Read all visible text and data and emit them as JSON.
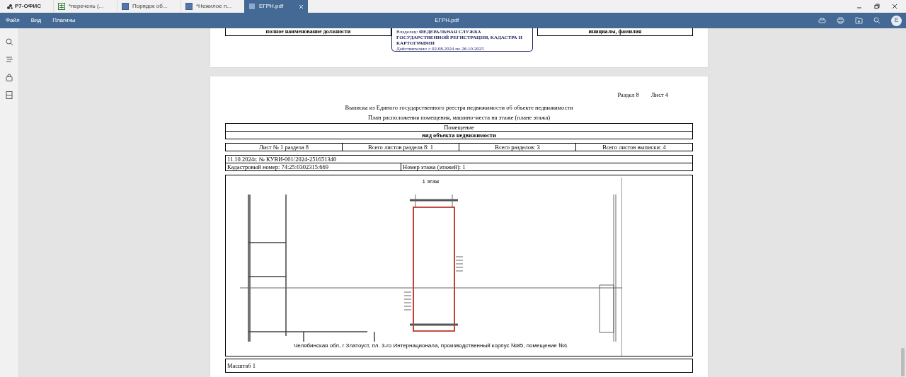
{
  "app": {
    "logo": "Р7-ОФИС"
  },
  "tabs": [
    {
      "label": "*перечень (...",
      "kind": "sheet",
      "selected": false
    },
    {
      "label": "Порядок об...",
      "kind": "doc",
      "selected": false
    },
    {
      "label": "*Нежилое п...",
      "kind": "doc",
      "selected": false
    },
    {
      "label": "ЕГРН.pdf",
      "kind": "pdf",
      "selected": true
    }
  ],
  "menu": [
    "Файл",
    "Вид",
    "Плагины"
  ],
  "title": "ЕГРН.pdf",
  "avatar": "Е",
  "page1": {
    "left_cell": "полное наименование должности",
    "right_cell": "инициалы, фамилия",
    "stamp": {
      "owner_label": "Владелец:",
      "owner": "ФЕДЕРАЛЬНАЯ СЛУЖБА ГОСУДАРСТВЕННОЙ РЕГИСТРАЦИИ, КАДАСТРА И КАРТОГРАФИИ",
      "valid_label": "Действителен:",
      "valid": "с 02.08.2024 по 26.10.2025"
    }
  },
  "page2": {
    "section": "Раздел 8",
    "sheet": "Лист 4",
    "title": "Выписка из Единого государственного реестра недвижимости об объекте недвижимости",
    "subtitle": "План расположения помещения, машино-места на этаже (плане этажа)",
    "object": "Помещение",
    "object_caption": "вид объекта недвижимости",
    "counts": [
      "Лист № 1 раздела 8",
      "Всего листов раздела 8: 1",
      "Всего разделов: 3",
      "Всего листов выписки: 4"
    ],
    "date_line": "11.10.2024г. № КУВИ-001/2024-251651340",
    "cadastral": "Кадастровый номер: 74:25:0302315:669",
    "floor": "Номер этажа (этажей): 1",
    "plan": {
      "caption": "1 этаж",
      "address": "Челябинская обл, г Златоуст, пл. 3-го Интернационала, производственный корпус №85, помещение №1"
    },
    "scale": "Масштаб 1"
  }
}
